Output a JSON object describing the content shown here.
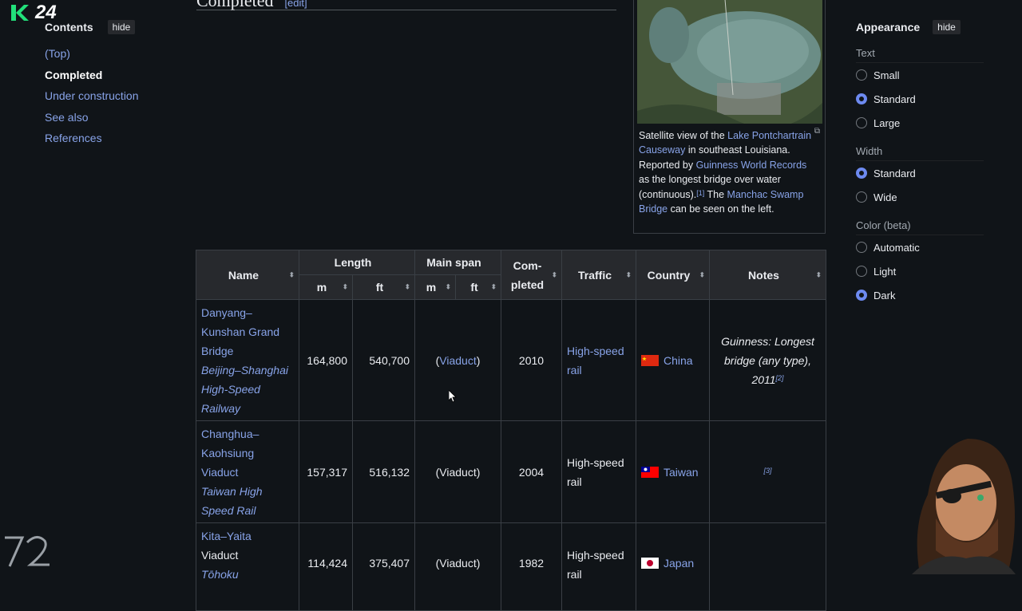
{
  "overlay": {
    "logo_number": "24"
  },
  "section": {
    "title": "Completed",
    "edit": "[edit]"
  },
  "toc": {
    "title": "Contents",
    "hide": "hide",
    "items": [
      "(Top)",
      "Completed",
      "Under construction",
      "See also",
      "References"
    ]
  },
  "figure": {
    "caption": {
      "t1": "Satellite view of the ",
      "l1": "Lake Pontchartrain Causeway",
      "t2": " in southeast Louisiana. Reported by ",
      "l2": "Guinness World Records",
      "t3": " as the longest bridge over water (continuous).",
      "r1": "[1]",
      "t4": " The ",
      "l3": "Manchac Swamp Bridge",
      "t5": " can be seen on the left."
    }
  },
  "appearance": {
    "title": "Appearance",
    "hide": "hide",
    "text_label": "Text",
    "text_options": [
      "Small",
      "Standard",
      "Large"
    ],
    "text_selected": "Standard",
    "width_label": "Width",
    "width_options": [
      "Standard",
      "Wide"
    ],
    "width_selected": "Standard",
    "color_label": "Color (beta)",
    "color_options": [
      "Automatic",
      "Light",
      "Dark"
    ],
    "color_selected": "Dark"
  },
  "table": {
    "headers": {
      "name": "Name",
      "length": "Length",
      "main_span": "Main span",
      "completed": "Com-pleted",
      "traffic": "Traffic",
      "country": "Country",
      "notes": "Notes",
      "m": "m",
      "ft": "ft"
    },
    "rows": [
      {
        "name": "Danyang–Kunshan Grand Bridge",
        "line": "Beijing–Shanghai High-Speed Railway",
        "length_m": "164,800",
        "length_ft": "540,700",
        "span": "(Viaduct)",
        "span_link": true,
        "completed": "2010",
        "traffic": "High-speed rail",
        "traffic_link": true,
        "country": "China",
        "notes": "Guinness: Longest bridge (any type), 2011",
        "notes_ref": "[2]"
      },
      {
        "name": "Changhua–Kaohsiung Viaduct",
        "line": "Taiwan High Speed Rail",
        "length_m": "157,317",
        "length_ft": "516,132",
        "span": "(Viaduct)",
        "span_link": false,
        "completed": "2004",
        "traffic": "High-speed rail",
        "traffic_link": false,
        "country": "Taiwan",
        "notes": "",
        "notes_ref": "[3]"
      },
      {
        "name": "Kita–Yaita Viaduct",
        "line": "Tōhoku",
        "length_m": "114,424",
        "length_ft": "375,407",
        "span": "(Viaduct)",
        "span_link": false,
        "completed": "1982",
        "traffic": "High-speed rail",
        "traffic_link": false,
        "country": "Japan",
        "notes": "",
        "notes_ref": ""
      }
    ]
  }
}
